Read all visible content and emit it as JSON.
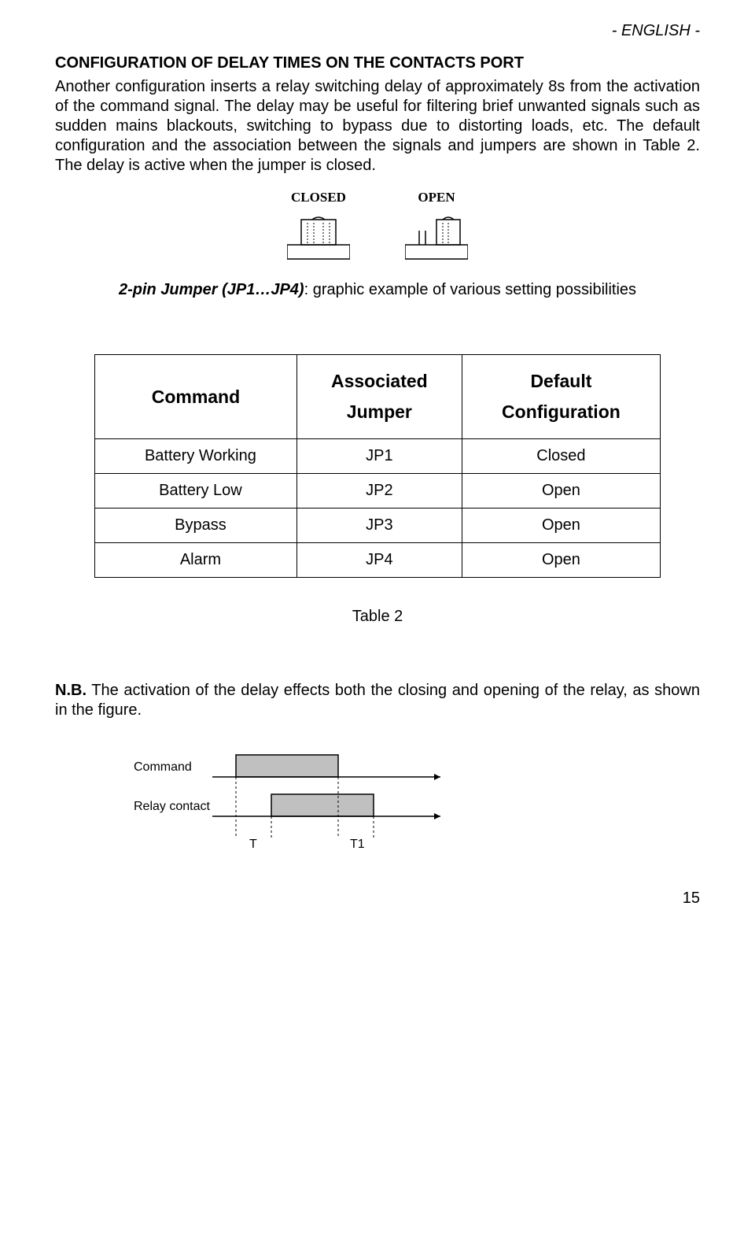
{
  "header": {
    "language": "- ENGLISH -"
  },
  "section": {
    "title": "CONFIGURATION OF DELAY TIMES ON THE CONTACTS PORT",
    "paragraph": "Another configuration inserts a relay switching delay of approximately 8s from the activation of the command signal. The delay may be useful for filtering brief unwanted signals such as sudden mains blackouts, switching to bypass due to distorting loads, etc. The default configuration and the association between the signals and jumpers are shown in Table 2. The delay is active when the jumper is closed."
  },
  "jumperDiagram": {
    "closed": "CLOSED",
    "open": "OPEN"
  },
  "caption": {
    "bold": "2-pin Jumper  (JP1…JP4)",
    "rest": ": graphic example of various setting possibilities"
  },
  "table": {
    "headers": {
      "command": "Command",
      "assoc_l1": "Associated",
      "assoc_l2": "Jumper",
      "default_l1": "Default",
      "default_l2": "Configuration"
    },
    "rows": [
      {
        "command": "Battery Working",
        "jumper": "JP1",
        "config": "Closed"
      },
      {
        "command": "Battery Low",
        "jumper": "JP2",
        "config": "Open"
      },
      {
        "command": "Bypass",
        "jumper": "JP3",
        "config": "Open"
      },
      {
        "command": "Alarm",
        "jumper": "JP4",
        "config": "Open"
      }
    ],
    "caption": "Table 2"
  },
  "nb": {
    "bold": "N.B.",
    "text": " The activation of the delay effects both the closing and opening of the relay, as shown in the figure."
  },
  "timing": {
    "command": "Command",
    "relay": "Relay contact",
    "t": "T",
    "t1": "T1"
  },
  "page": "15"
}
